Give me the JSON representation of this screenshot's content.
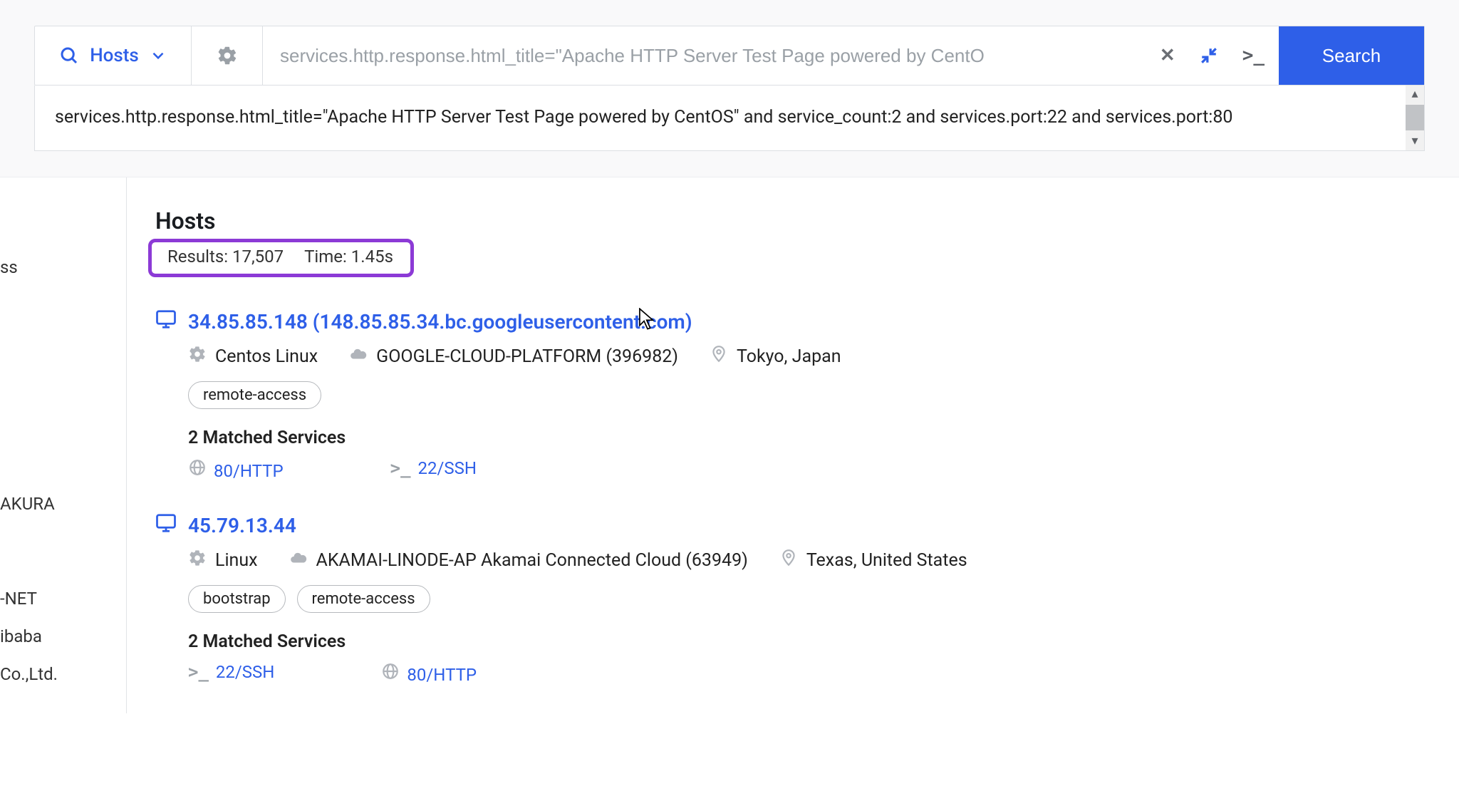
{
  "search": {
    "selector_label": "Hosts",
    "placeholder": "services.http.response.html_title=\"Apache HTTP Server Test Page powered by CentO",
    "button": "Search",
    "full_query": "services.http.response.html_title=\"Apache HTTP Server Test Page powered by CentOS\" and service_count:2 and services.port:22 and services.port:80"
  },
  "results_header": {
    "title": "Hosts",
    "results_label": "Results: 17,507",
    "time_label": "Time: 1.45s"
  },
  "sidebar_items": [
    "ss",
    "AKURA",
    "-NET",
    "ibaba",
    "Co.,Ltd."
  ],
  "results": [
    {
      "ip": "34.85.85.148",
      "host_suffix": " (148.85.85.34.bc.googleusercontent.com)",
      "os": "Centos Linux",
      "asn": "GOOGLE-CLOUD-PLATFORM (396982)",
      "location": "Tokyo, Japan",
      "tags": [
        "remote-access"
      ],
      "matched_header": "2 Matched Services",
      "services": [
        {
          "icon": "globe",
          "label": "80/HTTP"
        },
        {
          "icon": "prompt",
          "label": "22/SSH"
        }
      ]
    },
    {
      "ip": "45.79.13.44",
      "host_suffix": "",
      "os": "Linux",
      "asn": "AKAMAI-LINODE-AP Akamai Connected Cloud (63949)",
      "location": "Texas, United States",
      "tags": [
        "bootstrap",
        "remote-access"
      ],
      "matched_header": "2 Matched Services",
      "services": [
        {
          "icon": "prompt",
          "label": "22/SSH"
        },
        {
          "icon": "globe",
          "label": "80/HTTP"
        }
      ]
    }
  ]
}
